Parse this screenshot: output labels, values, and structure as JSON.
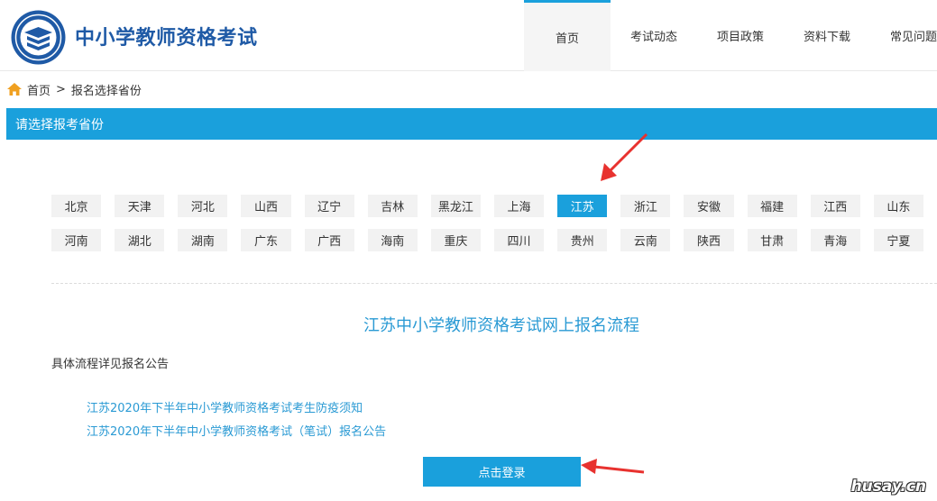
{
  "header": {
    "site_title": "中小学教师资格考试",
    "nav": [
      {
        "label": "首页",
        "active": true
      },
      {
        "label": "考试动态",
        "active": false
      },
      {
        "label": "项目政策",
        "active": false
      },
      {
        "label": "资料下载",
        "active": false
      },
      {
        "label": "常见问题",
        "active": false
      }
    ]
  },
  "breadcrumb": {
    "home": "首页",
    "separator": ">",
    "current": "报名选择省份"
  },
  "bar_title": "请选择报考省份",
  "provinces": {
    "row1": [
      "北京",
      "天津",
      "河北",
      "山西",
      "辽宁",
      "吉林",
      "黑龙江",
      "上海",
      "江苏",
      "浙江",
      "安徽",
      "福建",
      "江西",
      "山东"
    ],
    "row2": [
      "河南",
      "湖北",
      "湖南",
      "广东",
      "广西",
      "海南",
      "重庆",
      "四川",
      "贵州",
      "云南",
      "陕西",
      "甘肃",
      "青海",
      "宁夏"
    ],
    "selected": "江苏"
  },
  "process_title": "江苏中小学教师资格考试网上报名流程",
  "detail_note": "具体流程详见报名公告",
  "links": [
    "江苏2020年下半年中小学教师资格考试考生防疫须知",
    "江苏2020年下半年中小学教师资格考试（笔试）报名公告"
  ],
  "login_button": "点击登录",
  "watermark": "husay.cn",
  "colors": {
    "accent": "#1aa0dc",
    "brand_title": "#1f5aa6",
    "link": "#2a9ad4",
    "arrow": "#e8322f"
  }
}
